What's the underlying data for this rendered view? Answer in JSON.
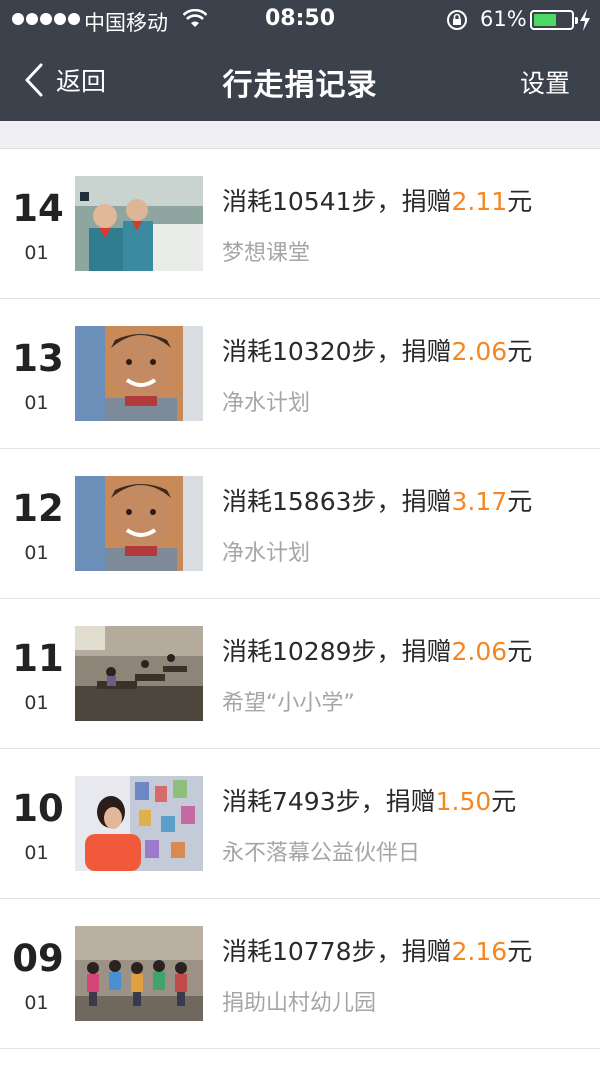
{
  "status_bar": {
    "carrier": "中国移动",
    "time": "08:50",
    "battery": "61%",
    "battery_level": 0.61
  },
  "nav": {
    "back_label": "返回",
    "title": "行走捐记录",
    "settings_label": "设置"
  },
  "colors": {
    "nav_bg": "#3c424c",
    "accent_orange": "#f6861f",
    "battery_green": "#4cd964",
    "subtitle_gray": "#a6a6a6"
  },
  "records": [
    {
      "day": "14",
      "month": "01",
      "prefix": "消耗10541步，捐赠",
      "amount": "2.11",
      "unit": "元",
      "project": "梦想课堂",
      "thumb": "classroom-kids-photo"
    },
    {
      "day": "13",
      "month": "01",
      "prefix": "消耗10320步，捐赠",
      "amount": "2.06",
      "unit": "元",
      "project": "净水计划",
      "thumb": "smiling-boy-photo"
    },
    {
      "day": "12",
      "month": "01",
      "prefix": "消耗15863步，捐赠",
      "amount": "3.17",
      "unit": "元",
      "project": "净水计划",
      "thumb": "smiling-boy-photo"
    },
    {
      "day": "11",
      "month": "01",
      "prefix": "消耗10289步，捐赠",
      "amount": "2.06",
      "unit": "元",
      "project": "希望“小小学”",
      "thumb": "rural-classroom-photo"
    },
    {
      "day": "10",
      "month": "01",
      "prefix": "消耗7493步，捐赠",
      "amount": "1.50",
      "unit": "元",
      "project": "永不落幕公益伙伴日",
      "thumb": "girl-art-wall-photo"
    },
    {
      "day": "09",
      "month": "01",
      "prefix": "消耗10778步，捐赠",
      "amount": "2.16",
      "unit": "元",
      "project": "捐助山村幼儿园",
      "thumb": "kindergarten-children-photo"
    }
  ]
}
